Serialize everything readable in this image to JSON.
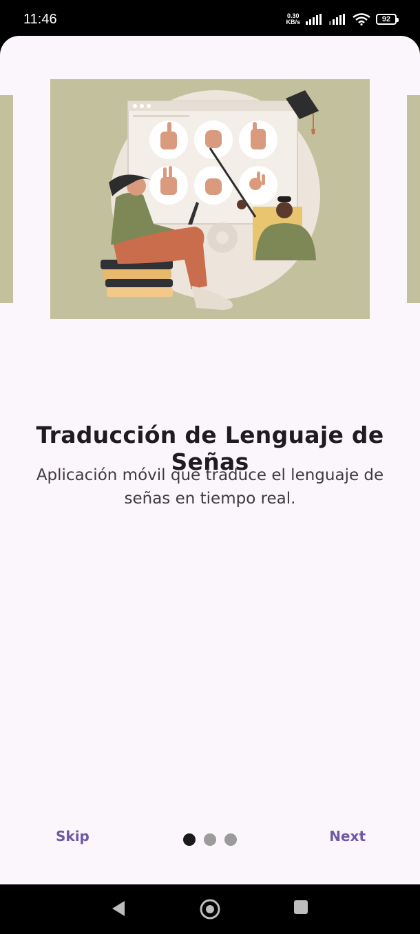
{
  "status_bar": {
    "time": "11:46",
    "speed_value": "0.30",
    "speed_unit": "KB/s",
    "battery": "92"
  },
  "onboarding": {
    "title": "Traducción de Lenguaje de Señas",
    "subtitle": "Aplicación móvil que traduce el lenguaje de señas en tiempo real.",
    "skip_label": "Skip",
    "next_label": "Next",
    "page_count": 3,
    "active_page": 1
  },
  "colors": {
    "sheet_background": "#fbf6fb",
    "accent": "#6c5aa5",
    "illustration_background": "#c3c09d"
  }
}
